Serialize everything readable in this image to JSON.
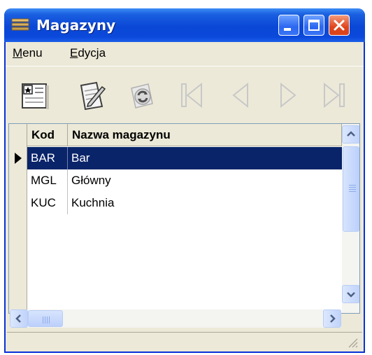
{
  "window": {
    "title": "Magazyny"
  },
  "menu": {
    "items": [
      {
        "label_first": "M",
        "label_rest": "enu"
      },
      {
        "label_first": "E",
        "label_rest": "dycja"
      }
    ]
  },
  "toolbar": {
    "icons": [
      "new-record-icon",
      "edit-icon",
      "refresh-icon",
      "first-record-icon",
      "prev-record-icon",
      "next-record-icon",
      "last-record-icon"
    ]
  },
  "grid": {
    "columns": [
      "Kod",
      "Nazwa magazynu"
    ],
    "rows": [
      {
        "code": "BAR",
        "name": "Bar"
      },
      {
        "code": "MGL",
        "name": "Główny"
      },
      {
        "code": "KUC",
        "name": "Kuchnia"
      }
    ],
    "selected_row": 0
  },
  "colors": {
    "titlebar": "#0a47d6",
    "selection": "#0a246a",
    "window_bg": "#ece9d8"
  }
}
